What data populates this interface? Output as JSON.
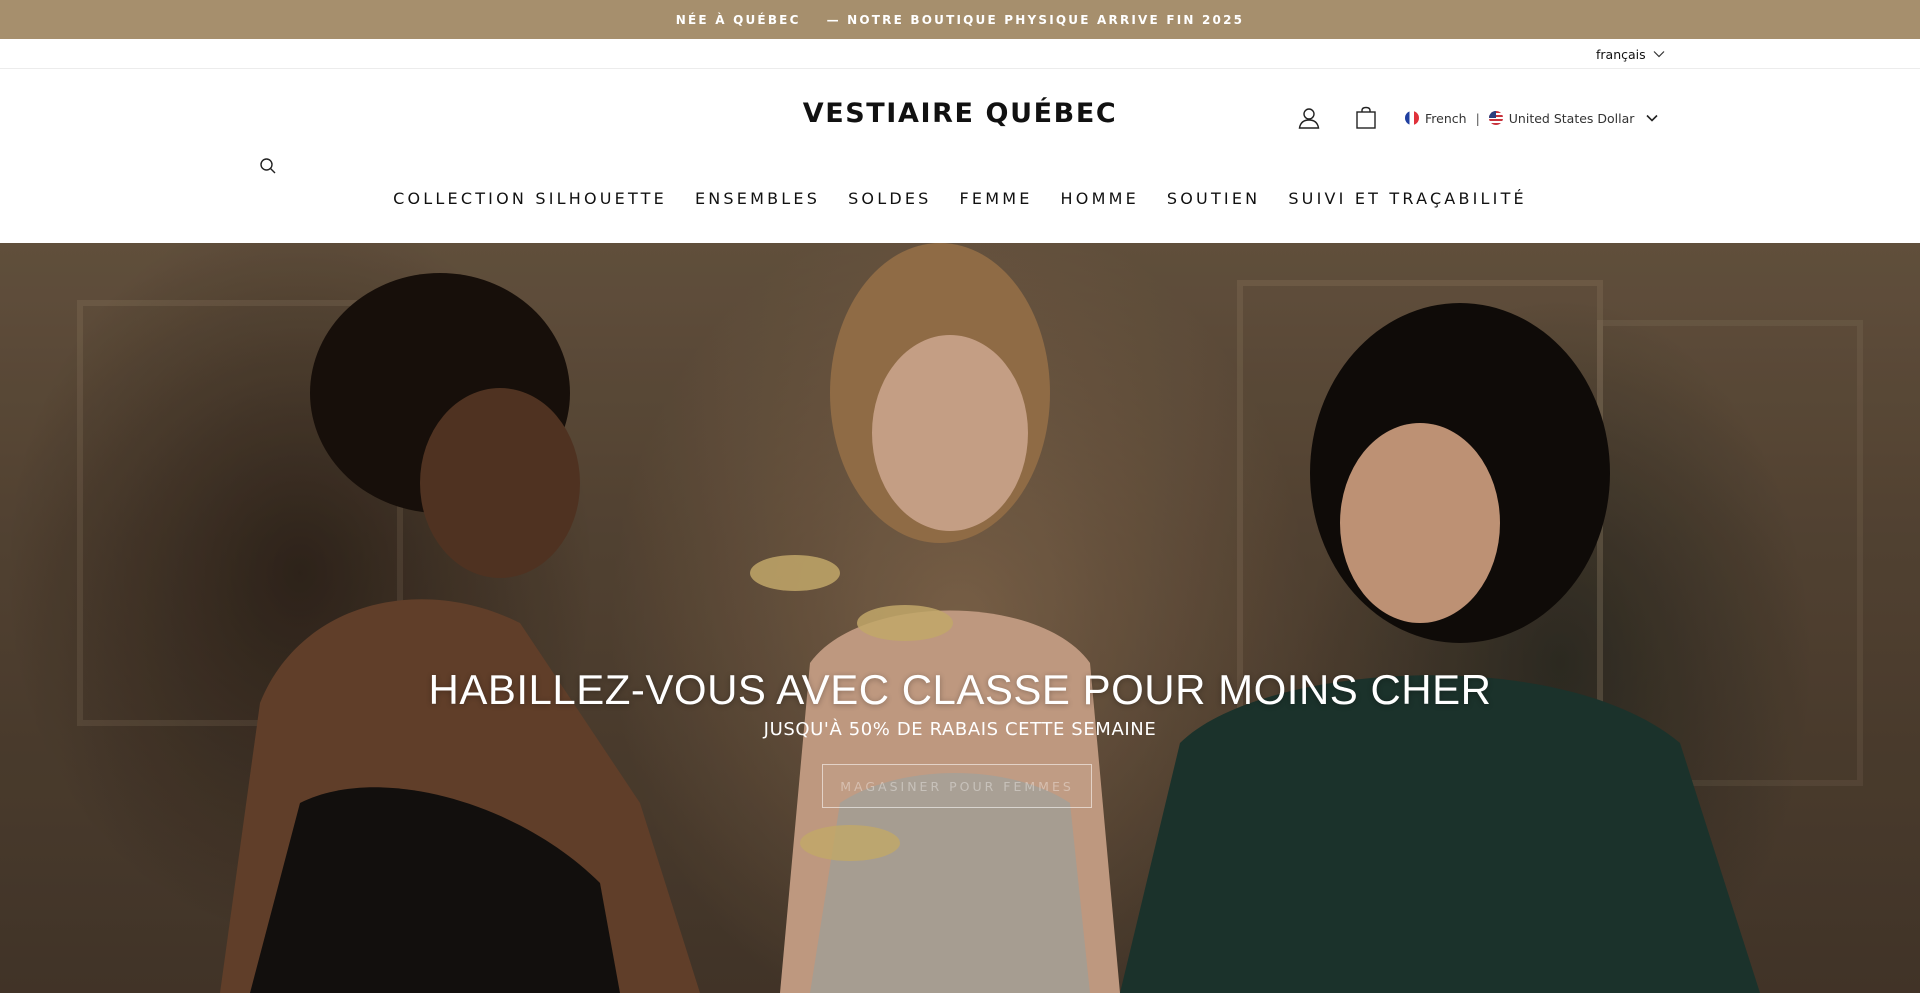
{
  "announcement": {
    "left": "NÉE À QUÉBEC",
    "right": "— NOTRE BOUTIQUE PHYSIQUE ARRIVE FIN 2025"
  },
  "language": {
    "selected": "français"
  },
  "header": {
    "logo": "VESTIAIRE QUÉBEC",
    "locale": {
      "language": "French",
      "separator": "|",
      "currency": "United States Dollar"
    }
  },
  "nav": {
    "items": [
      {
        "label": "COLLECTION SILHOUETTE"
      },
      {
        "label": "ENSEMBLES"
      },
      {
        "label": "SOLDES"
      },
      {
        "label": "FEMME"
      },
      {
        "label": "HOMME"
      },
      {
        "label": "SOUTIEN"
      },
      {
        "label": "SUIVI ET TRAÇABILITÉ"
      }
    ]
  },
  "hero": {
    "title": "HABILLEZ-VOUS AVEC CLASSE POUR MOINS CHER",
    "subtitle": "JUSQU'À 50% DE RABAIS CETTE SEMAINE",
    "cta": "MAGASINER POUR FEMMES"
  },
  "colors": {
    "announcement_bg": "#a68f6d",
    "text": "#111111",
    "hero_text": "#ffffff"
  },
  "icons": [
    "search-icon",
    "user-icon",
    "shopping-bag-icon",
    "chevron-down-icon",
    "flag-fr-icon",
    "flag-us-icon"
  ]
}
